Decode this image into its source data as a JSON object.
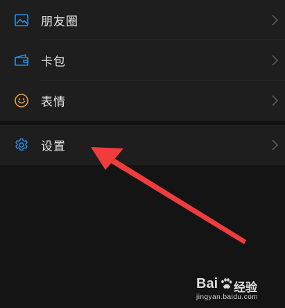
{
  "colors": {
    "background": "#121212",
    "row_background": "#1e1e1e",
    "label": "#e6e6e6",
    "icon_blue": "#2a8ee6",
    "icon_orange": "#e69a3b",
    "chevron": "#5a5a5a",
    "arrow": "#f03c3c"
  },
  "menu": {
    "items": [
      {
        "icon": "moments-image-icon",
        "label": "朋友圈"
      },
      {
        "icon": "card-wallet-icon",
        "label": "卡包"
      },
      {
        "icon": "smiley-face-icon",
        "label": "表情"
      },
      {
        "icon": "gear-icon",
        "label": "设置"
      }
    ]
  },
  "watermark": {
    "brand": "Bai",
    "brand_suffix": "经验",
    "url": "jingyan.baidu.com"
  }
}
